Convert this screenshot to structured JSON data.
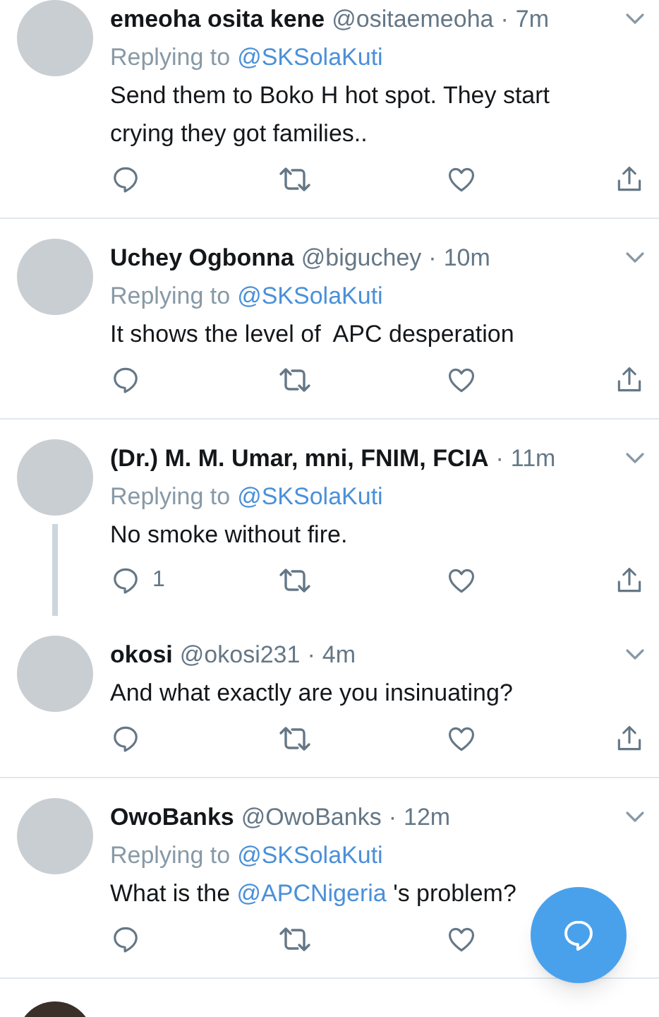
{
  "tweets": [
    {
      "name": "emeoha osita kene",
      "handle": "@ositaemeoha",
      "separator": "·",
      "time": "7m",
      "replying_label": "Replying to",
      "replying_to": "@SKSolaKuti",
      "text_parts": [
        {
          "kind": "plain",
          "text": "Send them to Boko H hot spot. They start crying they got families.."
        }
      ],
      "thread_to_next": false,
      "share_shown": true
    },
    {
      "name": "Uchey Ogbonna",
      "handle": "@biguchey",
      "separator": "·",
      "time": "10m",
      "replying_label": "Replying to",
      "replying_to": "@SKSolaKuti",
      "text_parts": [
        {
          "kind": "plain",
          "text": "It shows the level of  APC desperation"
        }
      ],
      "thread_to_next": false,
      "share_shown": true
    },
    {
      "name": "(Dr.) M. M. Umar, mni, FNIM, FCIA",
      "separator": "·",
      "time": "11m",
      "replying_label": "Replying to",
      "replying_to": "@SKSolaKuti",
      "text_parts": [
        {
          "kind": "plain",
          "text": "No smoke without fire."
        }
      ],
      "reply_count": "1",
      "thread_to_next": true,
      "share_shown": true
    },
    {
      "name": "okosi",
      "handle": "@okosi231",
      "separator": "·",
      "time": "4m",
      "text_parts": [
        {
          "kind": "plain",
          "text": "And what exactly are you insinuating?"
        }
      ],
      "thread_to_next": false,
      "share_shown": true
    },
    {
      "name": "OwoBanks",
      "handle": "@OwoBanks",
      "separator": "·",
      "time": "12m",
      "replying_label": "Replying to",
      "replying_to": "@SKSolaKuti",
      "text_parts": [
        {
          "kind": "plain",
          "text": "What is the "
        },
        {
          "kind": "mention",
          "text": "@APCNigeria"
        },
        {
          "kind": "plain",
          "text": " 's problem?"
        }
      ],
      "thread_to_next": false,
      "share_shown": false
    }
  ]
}
